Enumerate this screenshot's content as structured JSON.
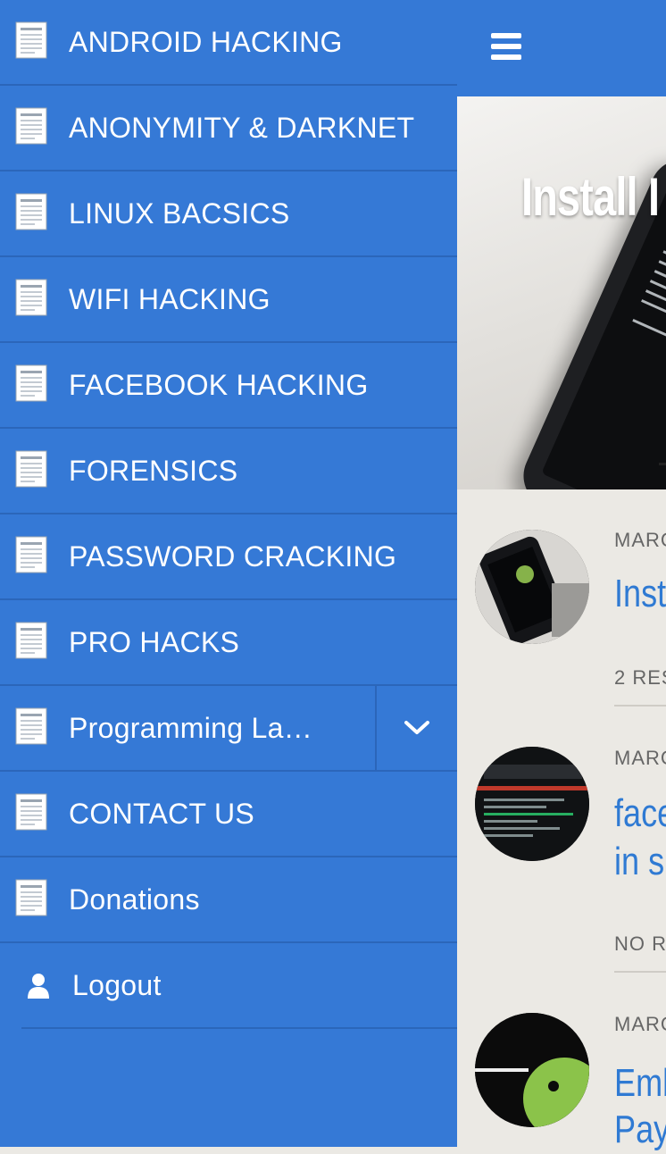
{
  "topbar": {
    "menu_icon": "hamburger-icon"
  },
  "hero": {
    "title": "Install I"
  },
  "drawer": {
    "items": [
      {
        "label": "ANDROID HACKING",
        "icon": "document-icon"
      },
      {
        "label": "ANONYMITY & DARKNET",
        "icon": "document-icon"
      },
      {
        "label": "LINUX BACSICS",
        "icon": "document-icon"
      },
      {
        "label": "WIFI HACKING",
        "icon": "document-icon"
      },
      {
        "label": "FACEBOOK HACKING",
        "icon": "document-icon"
      },
      {
        "label": "FORENSICS",
        "icon": "document-icon"
      },
      {
        "label": "PASSWORD CRACKING",
        "icon": "document-icon"
      },
      {
        "label": "PRO HACKS",
        "icon": "document-icon"
      },
      {
        "label": "Programming Languages",
        "icon": "document-icon",
        "expander_icon": "chevron-down-icon"
      },
      {
        "label": "CONTACT US",
        "icon": "document-icon"
      },
      {
        "label": "Donations",
        "icon": "document-icon"
      }
    ],
    "logout": {
      "label": "Logout",
      "icon": "user-icon"
    }
  },
  "posts": [
    {
      "date": "MARC",
      "title_lines": [
        "Insta"
      ],
      "meta": "2 RES"
    },
    {
      "date": "MARC",
      "title_lines": [
        "face",
        "in sh"
      ],
      "meta": "NO RI"
    },
    {
      "date": "MARC",
      "title_lines": [
        "Emb",
        "Payl"
      ],
      "meta": ""
    }
  ],
  "colors": {
    "drawer": "#3579d6",
    "divider": "#2b66ba",
    "link": "#2f7ad3",
    "content_bg": "#ebe9e4"
  }
}
